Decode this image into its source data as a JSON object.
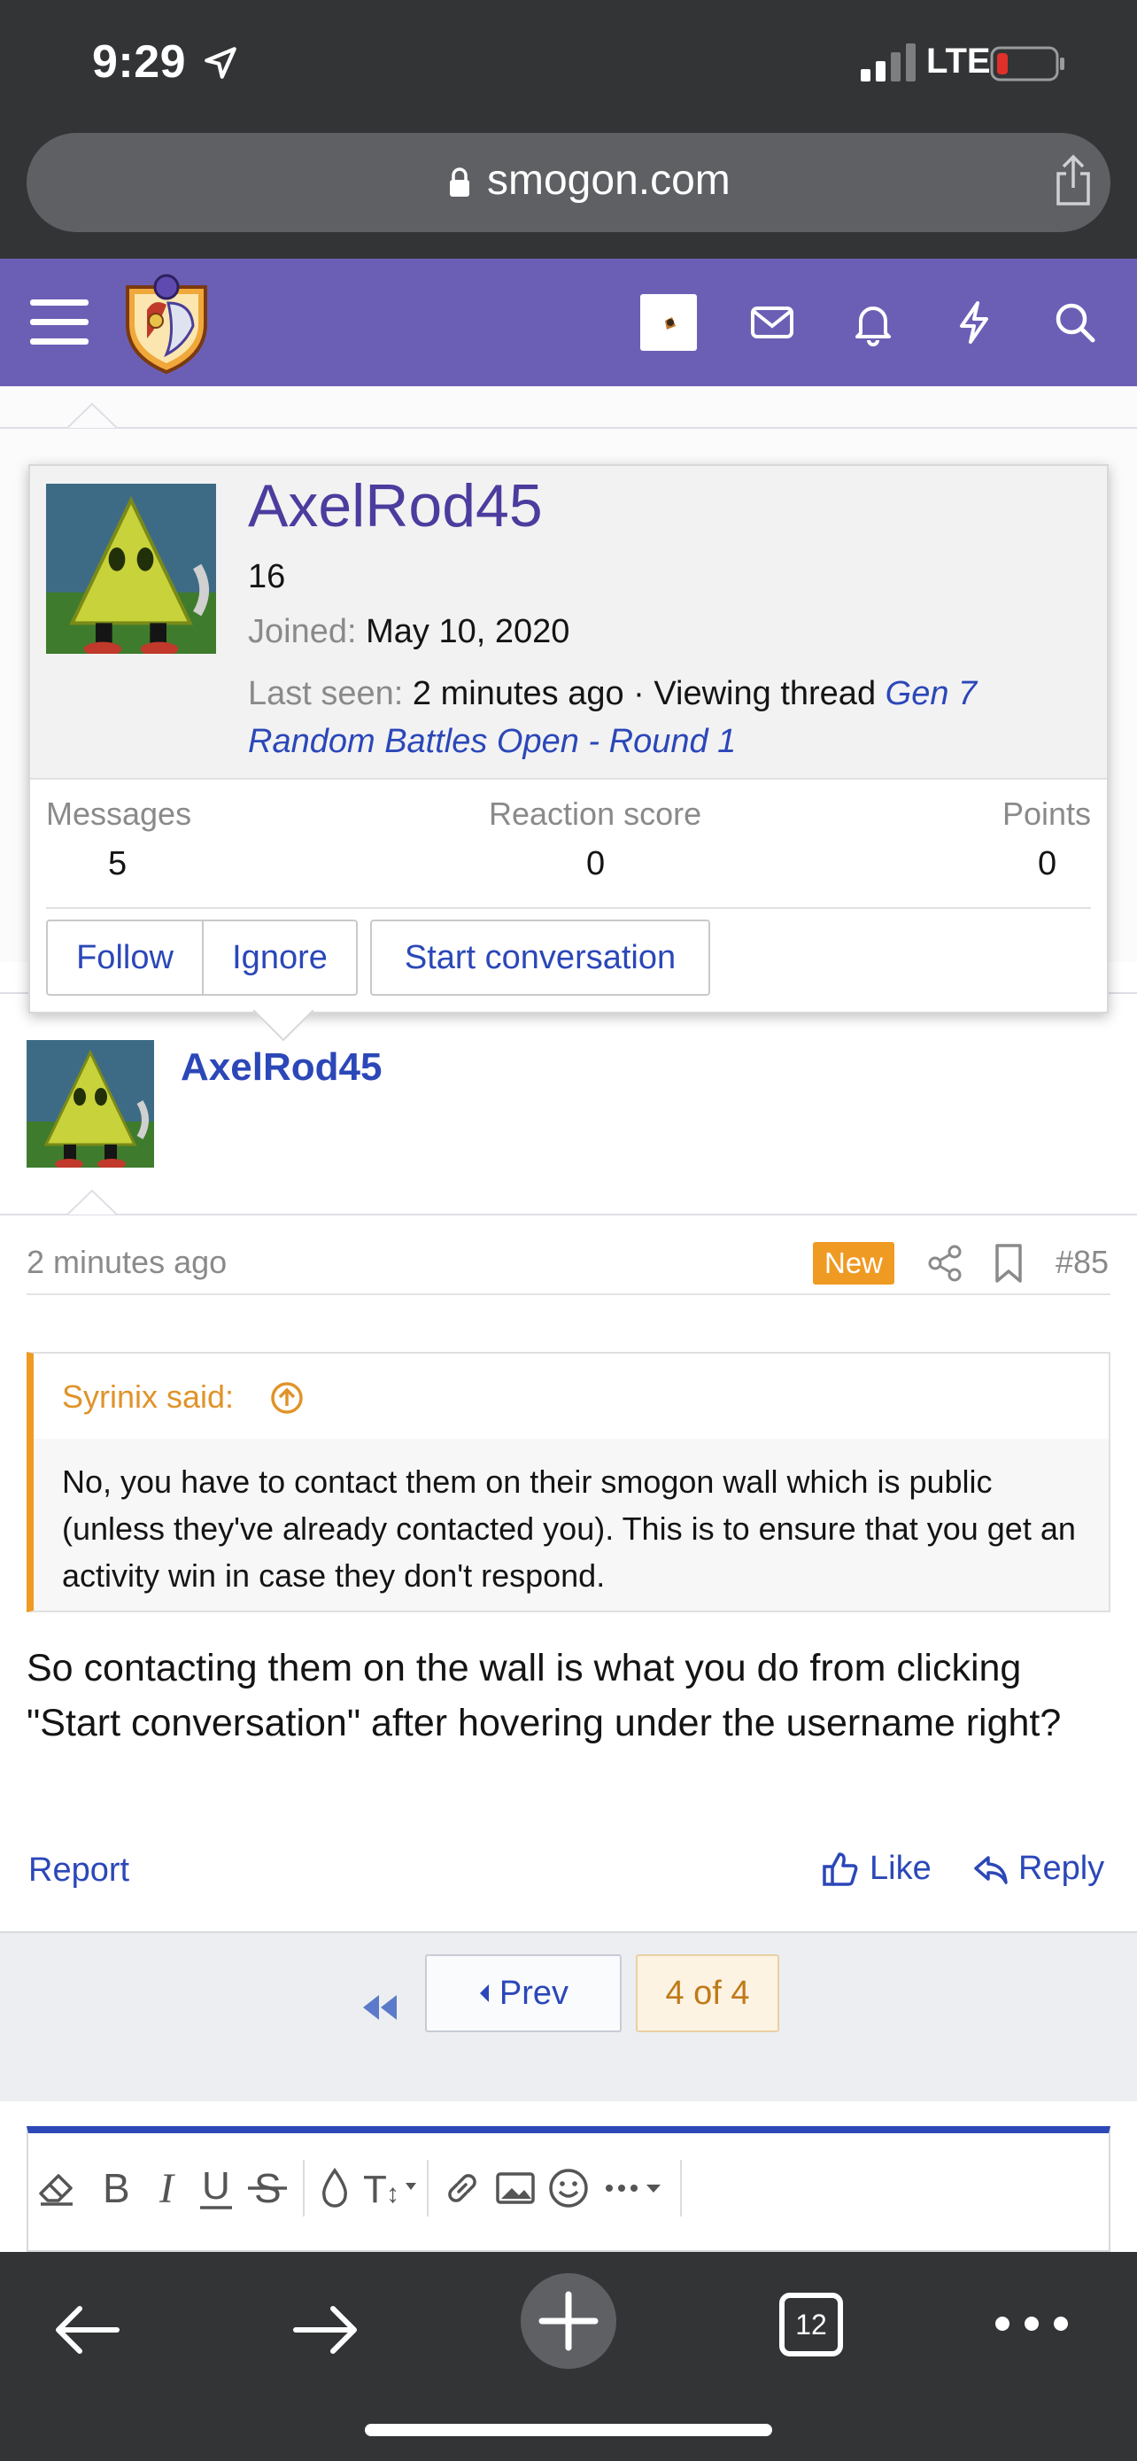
{
  "status_bar": {
    "time": "9:29",
    "network": "LTE"
  },
  "browser": {
    "url": "smogon.com"
  },
  "member_tooltip": {
    "username": "AxelRod45",
    "user_title": "16",
    "joined_label": "Joined:",
    "joined_value": "May 10, 2020",
    "last_seen_label": "Last seen:",
    "last_seen_value": "2 minutes ago · Viewing thread ",
    "thread_link": "Gen 7 Random Battles Open - Round 1",
    "stats": [
      {
        "label": "Messages",
        "value": "5"
      },
      {
        "label": "Reaction score",
        "value": "0"
      },
      {
        "label": "Points",
        "value": "0"
      }
    ],
    "buttons": {
      "follow": "Follow",
      "ignore": "Ignore",
      "start_conversation": "Start conversation"
    }
  },
  "post": {
    "username": "AxelRod45",
    "time": "2 minutes ago",
    "badge": "New",
    "number": "#85",
    "quote_attribution": "Syrinix said:",
    "quote_text": "No, you have to contact them on their smogon wall which is public (unless they've already contacted you). This is to ensure that you get an activity win in case they don't respond.",
    "body": "So contacting them on the wall is what you do from clicking \"Start conversation\" after hovering under the username right?",
    "actions": {
      "report": "Report",
      "like": "Like",
      "reply": "Reply"
    }
  },
  "pagination": {
    "prev": "Prev",
    "current": "4 of 4"
  },
  "safari": {
    "tab_count": "12"
  },
  "colors": {
    "header": "#6b5fb5",
    "link": "#2b47b8",
    "accent": "#ef9a22"
  }
}
